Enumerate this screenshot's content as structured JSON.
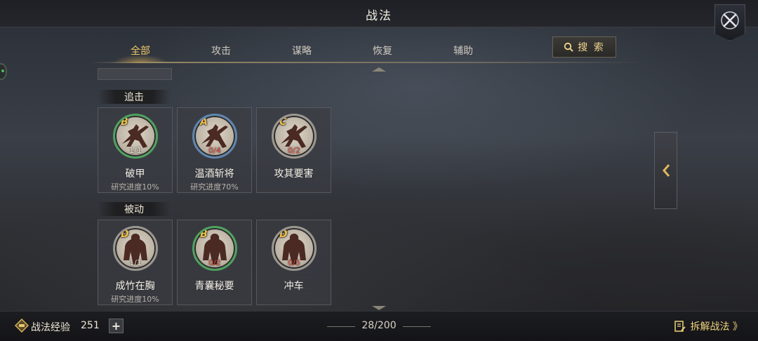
{
  "header": {
    "title": "战法"
  },
  "tabs": [
    {
      "label": "全部",
      "active": true
    },
    {
      "label": "攻击",
      "active": false
    },
    {
      "label": "谋略",
      "active": false
    },
    {
      "label": "恢复",
      "active": false
    },
    {
      "label": "辅助",
      "active": false
    }
  ],
  "search": {
    "label": "搜 索",
    "icon": "search-icon"
  },
  "sections": [
    {
      "label": "追击",
      "cards": [
        {
          "grade": "B",
          "level": "1/1",
          "name": "破甲",
          "progress": "研究进度10%",
          "ring": "#4fa15e"
        },
        {
          "grade": "A",
          "level": "0/4",
          "name": "温酒斩将",
          "progress": "研究进度70%",
          "ring": "#5f86b0"
        },
        {
          "grade": "C",
          "level": "0/2",
          "name": "攻其要害",
          "progress": "",
          "ring": "#9b978f"
        }
      ]
    },
    {
      "label": "被动",
      "cards": [
        {
          "grade": "D",
          "level": "1/1",
          "name": "成竹在胸",
          "progress": "研究进度10%",
          "ring": "#9b978f"
        },
        {
          "grade": "B",
          "level": "0/2",
          "name": "青囊秘要",
          "progress": "",
          "ring": "#4fa15e"
        },
        {
          "grade": "D",
          "level": "0/5",
          "name": "冲车",
          "progress": "",
          "ring": "#9b978f"
        }
      ]
    }
  ],
  "footer": {
    "exp_label": "战法经验",
    "exp_value": "251",
    "plus_label": "+",
    "count": "28/200",
    "dismantle_label": "拆解战法 》"
  },
  "colors": {
    "accent_gold": "#f0c86a",
    "level_red": "#e0524a"
  }
}
